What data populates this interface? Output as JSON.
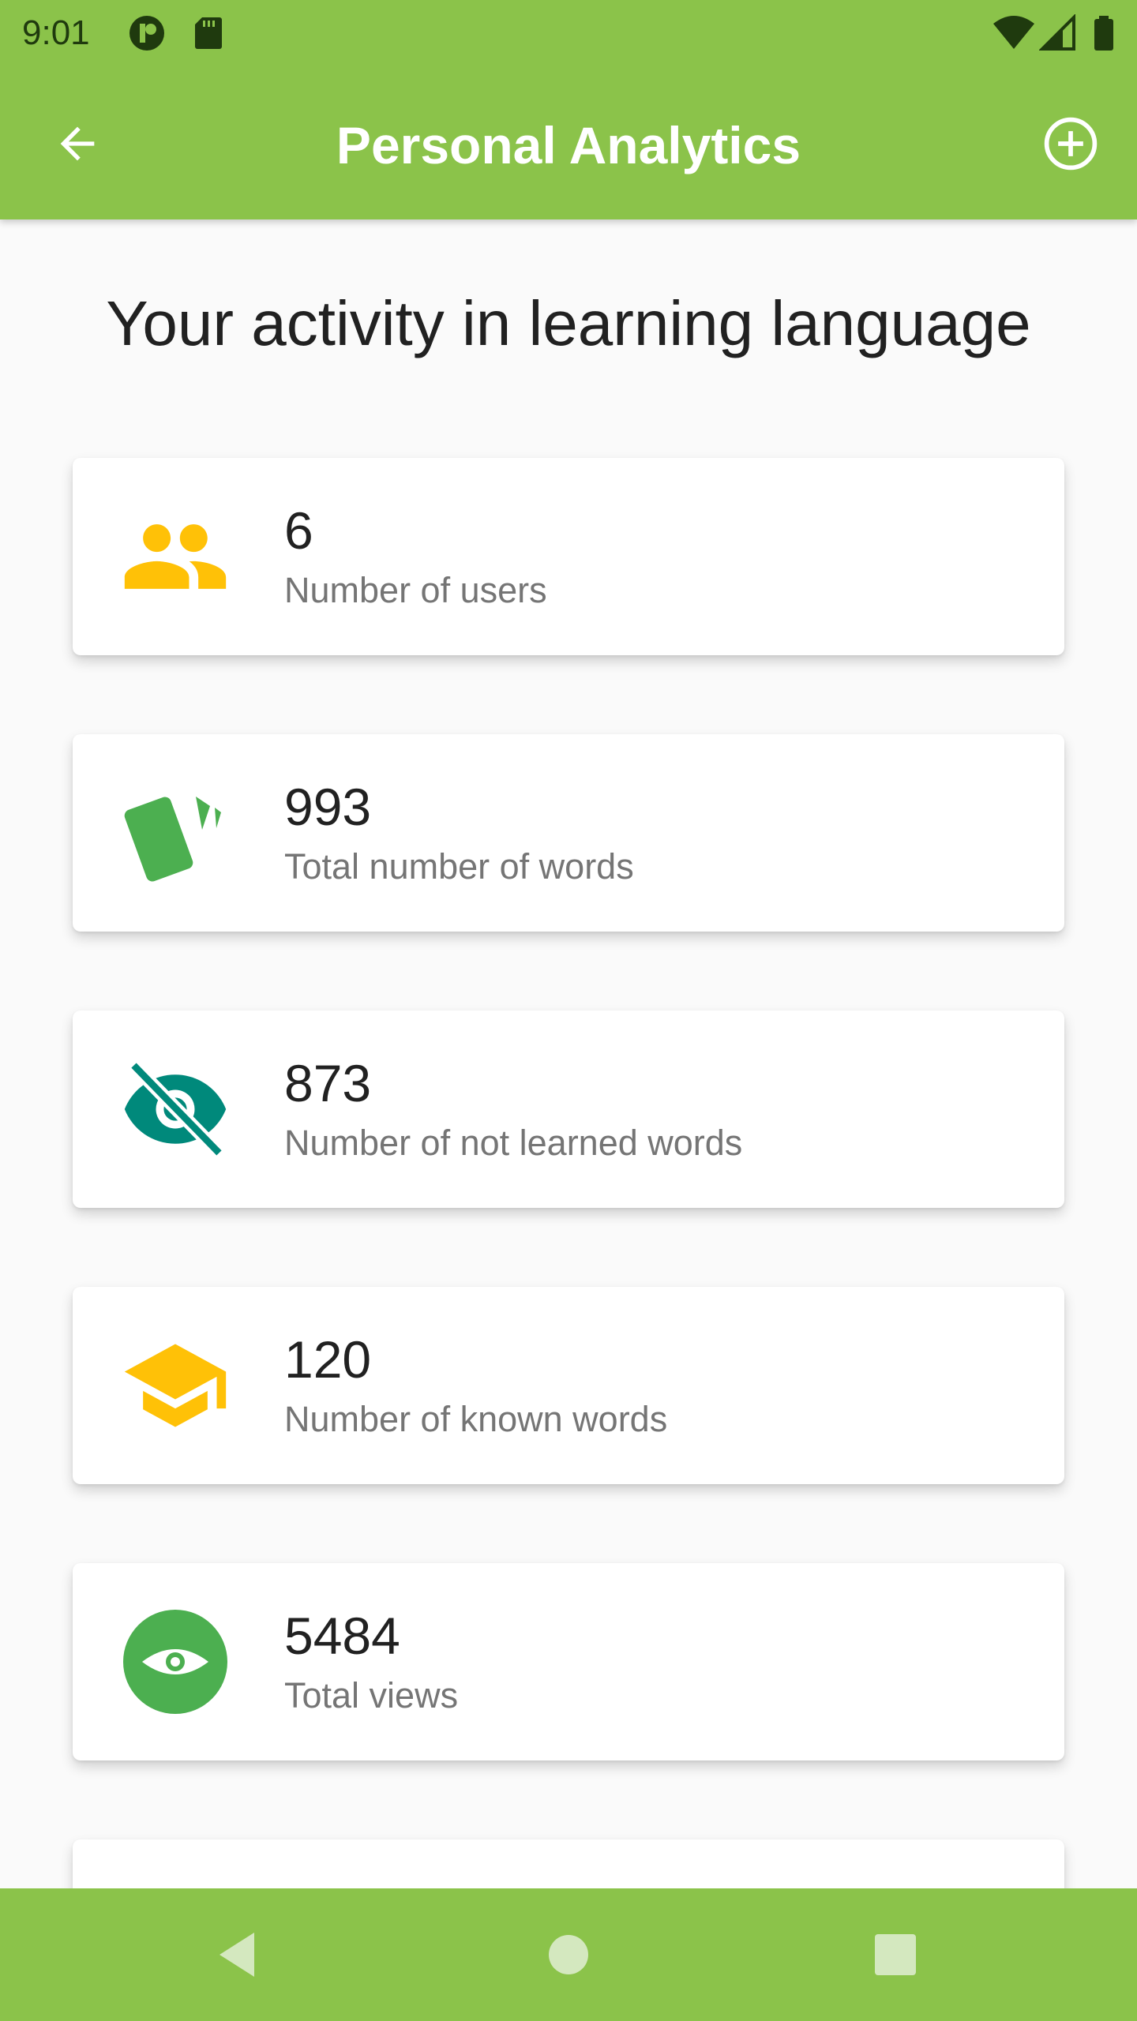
{
  "status_bar": {
    "time": "9:01",
    "icons_left": [
      "carrier-app-icon",
      "sd-card-icon"
    ],
    "icons_right": [
      "wifi-icon",
      "signal-icon",
      "battery-icon"
    ]
  },
  "app_bar": {
    "title": "Personal Analytics",
    "back_icon": "arrow-back-icon",
    "add_icon": "add-circle-icon",
    "color": "#8bc34a"
  },
  "heading": "Your activity in learning language",
  "stats": [
    {
      "value": "6",
      "label": "Number of users",
      "icon": "people-icon",
      "color": "#ffc107"
    },
    {
      "value": "993",
      "label": "Total number of words",
      "icon": "cards-icon",
      "color": "#4caf50"
    },
    {
      "value": "873",
      "label": "Number of not learned words",
      "icon": "visibility-off-icon",
      "color": "#00897b"
    },
    {
      "value": "120",
      "label": "Number of known words",
      "icon": "school-icon",
      "color": "#ffc107"
    },
    {
      "value": "5484",
      "label": "Total views",
      "icon": "visibility-icon",
      "color": "#4caf50"
    }
  ],
  "nav_bar": {
    "buttons": [
      "back-triangle-icon",
      "home-circle-icon",
      "recents-square-icon"
    ]
  }
}
